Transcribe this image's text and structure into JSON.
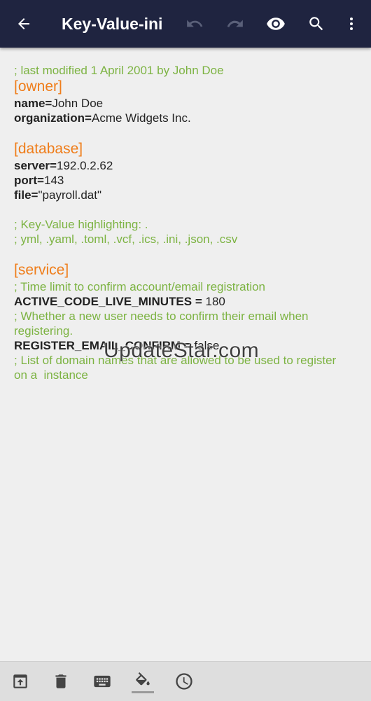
{
  "appbar": {
    "title": "Key-Value-ini",
    "icons": [
      "back-arrow-icon",
      "undo-icon",
      "redo-icon",
      "eye-icon",
      "search-icon",
      "more-vertical-icon"
    ]
  },
  "editor": {
    "header_comment": "; last modified 1 April 2001 by John Doe",
    "owner": {
      "section": "[owner]",
      "name_key": "name=",
      "name_value": "John Doe",
      "org_key": "organization=",
      "org_value": "Acme Widgets Inc."
    },
    "database": {
      "section": "[database]",
      "server_key": "server=",
      "server_value": "192.0.2.62",
      "port_key": "port=",
      "port_value": "143",
      "file_key": "file=",
      "file_value": "\"payroll.dat\""
    },
    "highlight_comment_1": "; Key-Value highlighting: .",
    "highlight_comment_2": "; yml, .yaml, .toml, .vcf, .ics, .ini, .json, .csv",
    "service": {
      "section": "[service]",
      "comment_1": "; Time limit to confirm account/email registration",
      "active_key": "ACTIVE_CODE_LIVE_MINUTES = ",
      "active_value": "180",
      "comment_2": "; Whether a new user needs to confirm their email when registering.",
      "register_key": "REGISTER_EMAIL_CONFIRM = ",
      "register_value": "false",
      "comment_3": "; List of domain names that are allowed to be used to register on a  instance"
    }
  },
  "watermark": "UpdateStar.com",
  "bottombar": {
    "icons": [
      "open-file-icon",
      "delete-icon",
      "keyboard-icon",
      "paint-bucket-icon",
      "history-clock-icon"
    ]
  },
  "colors": {
    "appbar": "#1f2440",
    "comment": "#7cb342",
    "section": "#ef7d1a",
    "background": "#efefef"
  }
}
